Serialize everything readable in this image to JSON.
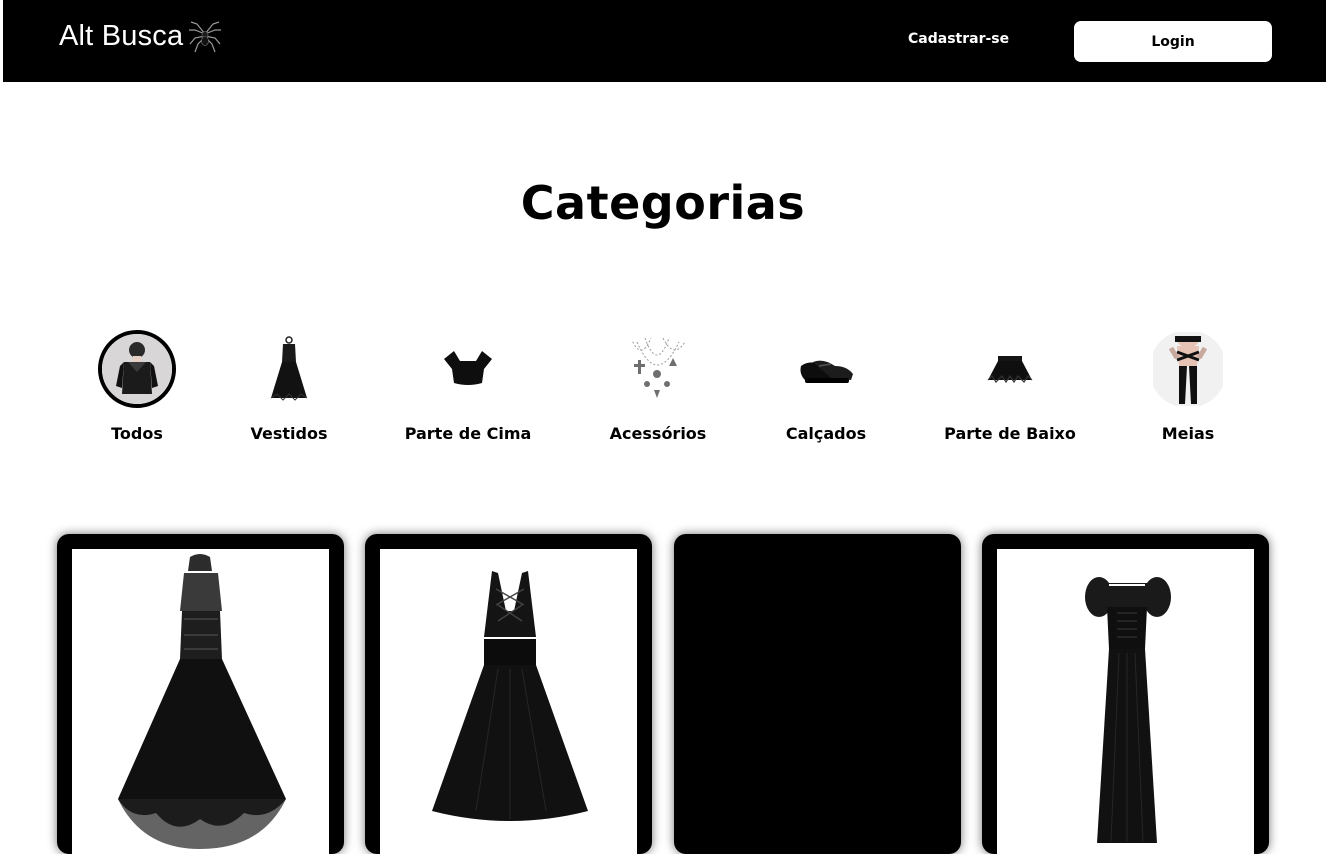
{
  "header": {
    "brand": "Alt Busca",
    "brand_icon": "spider-icon",
    "signup_label": "Cadastrar-se",
    "login_label": "Login"
  },
  "page": {
    "title": "Categorias"
  },
  "categories": [
    {
      "label": "Todos",
      "icon": "todos-thumbnail",
      "active": true
    },
    {
      "label": "Vestidos",
      "icon": "dress-thumbnail",
      "active": false
    },
    {
      "label": "Parte de Cima",
      "icon": "top-thumbnail",
      "active": false
    },
    {
      "label": "Acessórios",
      "icon": "necklaces-thumbnail",
      "active": false
    },
    {
      "label": "Calçados",
      "icon": "shoes-thumbnail",
      "active": false
    },
    {
      "label": "Parte de Baixo",
      "icon": "skirt-thumbnail",
      "active": false
    },
    {
      "label": "Meias",
      "icon": "stockings-thumbnail",
      "active": false
    }
  ],
  "products": [
    {
      "image": "halter-corset-dress-image"
    },
    {
      "image": "lace-up-dress-image"
    },
    {
      "image": ""
    },
    {
      "image": "puff-sleeve-maxi-dress-image"
    }
  ],
  "colors": {
    "header_bg": "#000000",
    "accent": "#000000",
    "background": "#ffffff"
  }
}
